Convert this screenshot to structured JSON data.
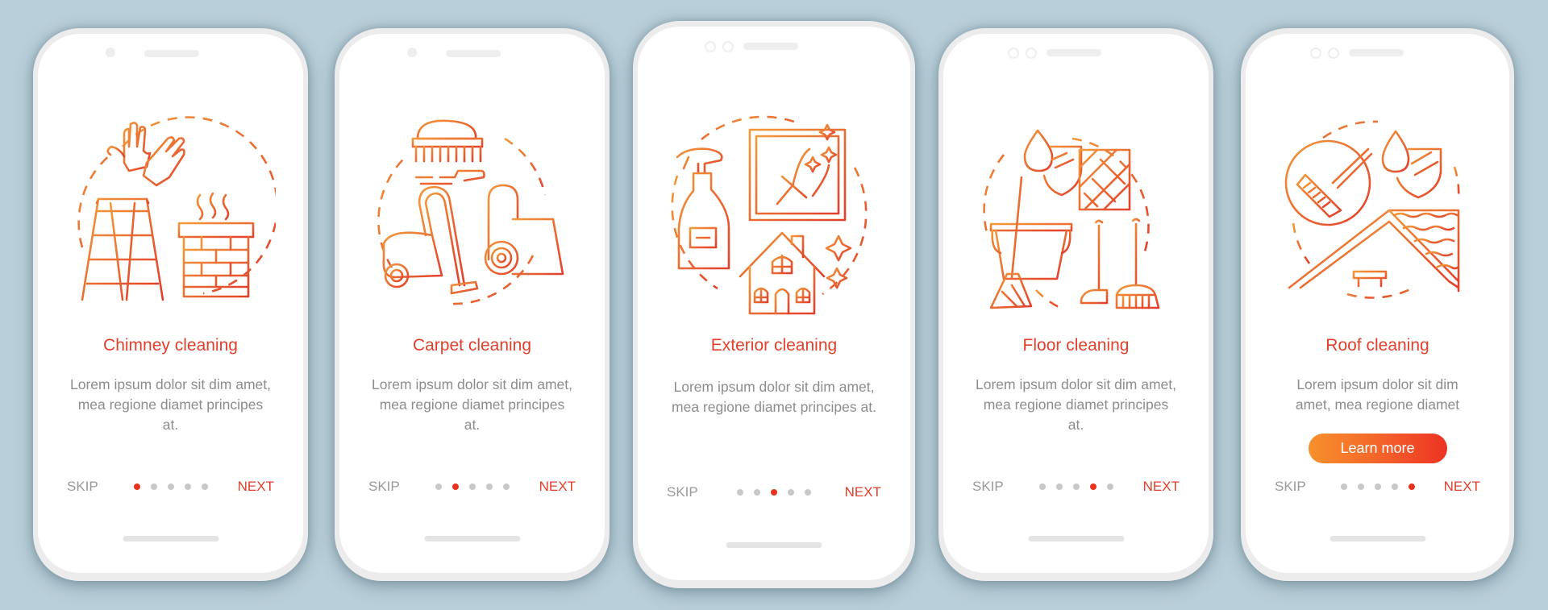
{
  "colors": {
    "background": "#b9cfd9",
    "accent": "#e2402c",
    "active_dot": "#e8321f",
    "inactive_dot": "#c8c8c8",
    "gradient_start": "#f7912c",
    "gradient_end": "#ec3323",
    "body_text": "#8d8d8d"
  },
  "screens": [
    {
      "title": "Chimney cleaning",
      "body": "Lorem ipsum dolor sit dim amet, mea regione diamet principes at.",
      "illustration": "chimney-cleaning-illustration",
      "skip_label": "SKIP",
      "next_label": "NEXT",
      "active_page": 1,
      "page_count": 5
    },
    {
      "title": "Carpet cleaning",
      "body": "Lorem ipsum dolor sit dim amet, mea regione diamet principes at.",
      "illustration": "carpet-cleaning-illustration",
      "skip_label": "SKIP",
      "next_label": "NEXT",
      "active_page": 2,
      "page_count": 5
    },
    {
      "title": "Exterior cleaning",
      "body": "Lorem ipsum dolor sit dim amet, mea regione diamet principes at.",
      "illustration": "exterior-cleaning-illustration",
      "skip_label": "SKIP",
      "next_label": "NEXT",
      "active_page": 3,
      "page_count": 5
    },
    {
      "title": "Floor cleaning",
      "body": "Lorem ipsum dolor sit dim amet, mea regione diamet principes at.",
      "illustration": "floor-cleaning-illustration",
      "skip_label": "SKIP",
      "next_label": "NEXT",
      "active_page": 4,
      "page_count": 5
    },
    {
      "title": "Roof cleaning",
      "body": "Lorem ipsum dolor sit dim amet, mea regione diamet",
      "illustration": "roof-cleaning-illustration",
      "button_label": "Learn more",
      "skip_label": "SKIP",
      "next_label": "NEXT",
      "active_page": 5,
      "page_count": 5
    }
  ]
}
